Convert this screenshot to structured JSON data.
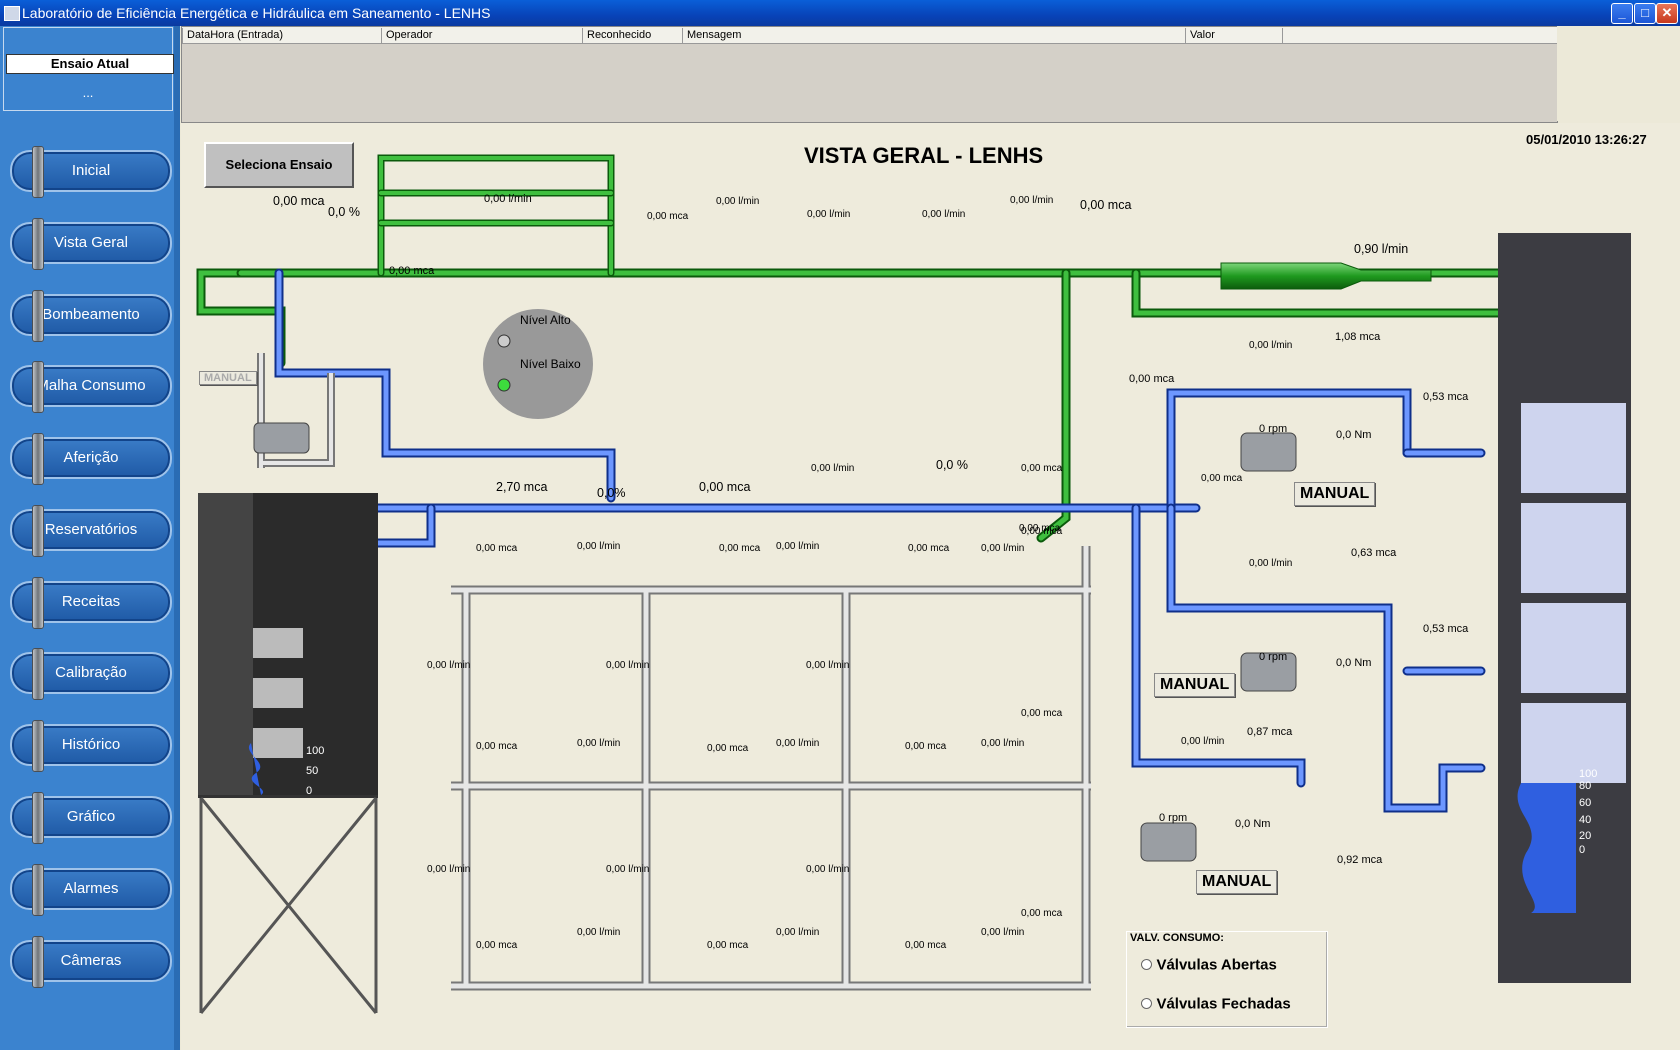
{
  "window": {
    "title": "Laboratório de Eficiência Energética e Hidráulica em Saneamento - LENHS",
    "min": "_",
    "max": "□",
    "close": "✕"
  },
  "ensaio": {
    "title": "Ensaio Atual",
    "value": "..."
  },
  "nav": [
    "Inicial",
    "Vista Geral",
    "Bombeamento",
    "Malha Consumo",
    "Aferição",
    "Reservatórios",
    "Receitas",
    "Calibração",
    "Histórico",
    "Gráfico",
    "Alarmes",
    "Câmeras"
  ],
  "alarms": {
    "columns": [
      "DataHora (Entrada)",
      "Operador",
      "Reconhecido",
      "Mensagem",
      "Valor"
    ]
  },
  "page": {
    "title": "VISTA GERAL - LENHS",
    "datetime": "05/01/2010 13:26:27",
    "select_button": "Seleciona Ensaio",
    "manual_small": "MANUAL"
  },
  "levels": {
    "high": "Nível Alto",
    "low": "Nível Baixo"
  },
  "readings": {
    "r1": "0,00 mca",
    "r2": "0,0 %",
    "r3": "0,00 l/min",
    "r4": "0,00 mca",
    "r5": "0,00 mca",
    "r6": "0,00 l/min",
    "r7": "0,00 l/min",
    "r8": "0,00 l/min",
    "r9": "0,00 l/min",
    "r10": "0,00 mca",
    "r11": "0,90 l/min",
    "r12": "2,70 mca",
    "r13": "0,0%",
    "r14": "0,00 mca",
    "r15": "0,00 l/min",
    "r16": "0,0 %",
    "r17": "0,00 mca",
    "r18": "0,00 mca",
    "r19": "0,00 mca",
    "r20": "0,00 mca",
    "r21": "0,00 l/min",
    "r22": "1,08 mca",
    "r23": "0,53 mca",
    "r24": "0 rpm",
    "r25": "0,0 Nm",
    "r26": "0,00 l/min",
    "r27": "0,63 mca",
    "r28": "0,53 mca",
    "r29": "0 rpm",
    "r30": "0,0 Nm",
    "r31": "0,00 l/min",
    "r32": "0,87 mca",
    "r33": "0 rpm",
    "r34": "0,0 Nm",
    "r35": "0,92 mca",
    "r36": "0,00 mca",
    "r37": "0,00 mca",
    "r38": "0,00 mca"
  },
  "grid_labels": {
    "flow": "0,00 l/min",
    "pressure": "0,00 mca"
  },
  "tank_scale": {
    "left": [
      "100",
      "50",
      "0"
    ],
    "right": [
      "100",
      "80",
      "60",
      "40",
      "20",
      "0"
    ]
  },
  "manual_labels": [
    "MANUAL",
    "MANUAL",
    "MANUAL"
  ],
  "valv": {
    "title": "VALV. CONSUMO:",
    "open": "Válvulas Abertas",
    "closed": "Válvulas Fechadas"
  }
}
